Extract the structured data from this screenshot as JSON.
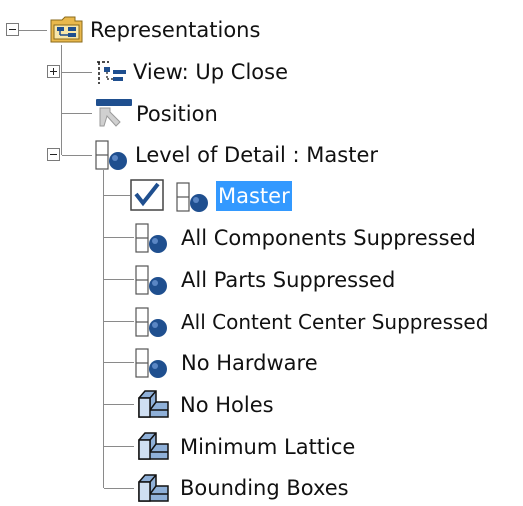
{
  "tree": {
    "root": {
      "label": "Representations",
      "icon": "representations-folder-icon",
      "expanded": true
    },
    "view": {
      "label": "View: Up Close",
      "icon": "view-representation-icon",
      "expanded": false
    },
    "position": {
      "label": "Position",
      "icon": "position-representation-icon"
    },
    "lod": {
      "label": "Level of Detail : Master",
      "icon": "level-of-detail-icon",
      "expanded": true,
      "items": [
        {
          "label": "Master",
          "icon": "level-of-detail-icon",
          "active": true,
          "selected": true
        },
        {
          "label": "All Components Suppressed",
          "icon": "level-of-detail-icon"
        },
        {
          "label": "All Parts Suppressed",
          "icon": "level-of-detail-icon"
        },
        {
          "label": "All Content Center Suppressed",
          "icon": "level-of-detail-icon"
        },
        {
          "label": "No Hardware",
          "icon": "level-of-detail-icon"
        },
        {
          "label": "No Holes",
          "icon": "substitute-part-icon"
        },
        {
          "label": "Minimum Lattice",
          "icon": "substitute-part-icon"
        },
        {
          "label": "Bounding Boxes",
          "icon": "substitute-part-icon"
        }
      ]
    }
  },
  "colors": {
    "selection": "#3399ff",
    "icon_blue": "#1f4f8f",
    "tree_lines": "#8a8a8a"
  }
}
